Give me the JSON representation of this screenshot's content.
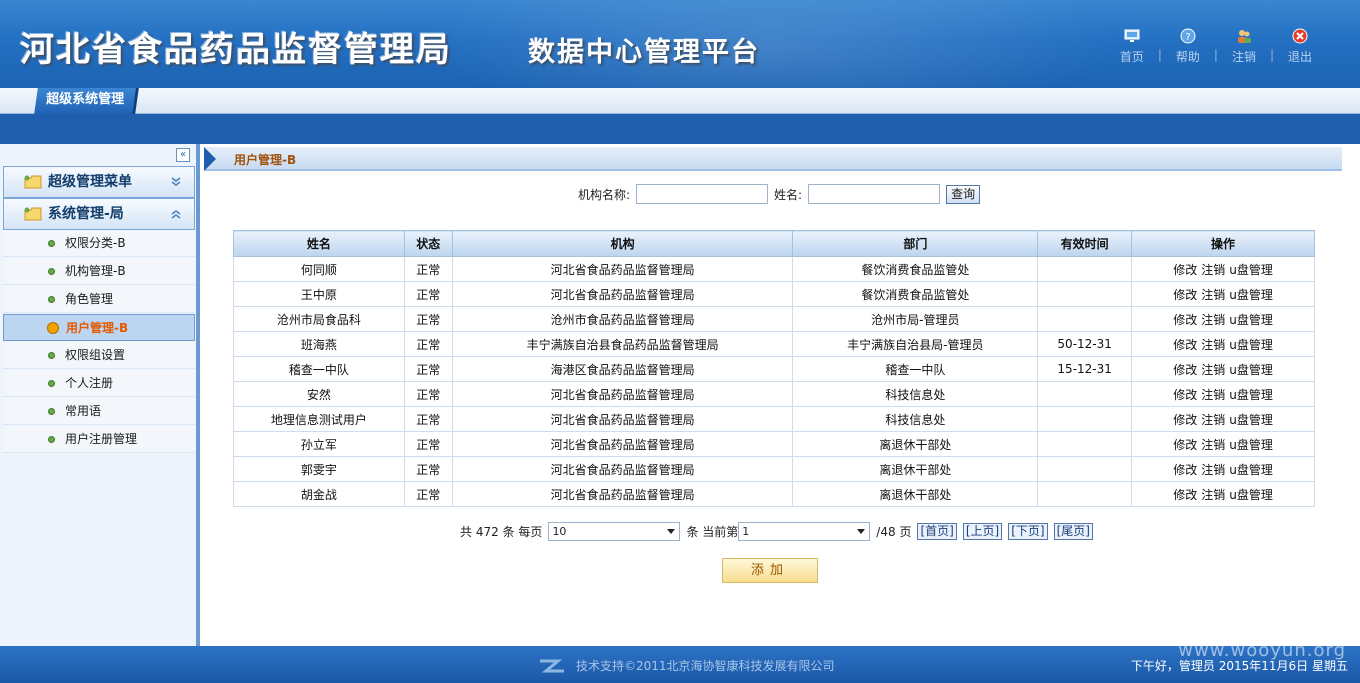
{
  "header": {
    "org_title": "河北省食品药品监督管理局",
    "platform_title": "数据中心管理平台",
    "nav": [
      {
        "label": "首页",
        "icon": "monitor-icon"
      },
      {
        "label": "帮助",
        "icon": "help-icon"
      },
      {
        "label": "注销",
        "icon": "users-icon"
      },
      {
        "label": "退出",
        "icon": "exit-icon"
      }
    ]
  },
  "tabs": {
    "active": "超级系统管理"
  },
  "sidebar": {
    "groups": [
      {
        "label": "超级管理菜单",
        "expanded": false
      },
      {
        "label": "系统管理-局",
        "expanded": true
      }
    ],
    "items": [
      {
        "label": "权限分类-B"
      },
      {
        "label": "机构管理-B"
      },
      {
        "label": "角色管理"
      },
      {
        "label": "用户管理-B",
        "active": true
      },
      {
        "label": "权限组设置"
      },
      {
        "label": "个人注册"
      },
      {
        "label": "常用语"
      },
      {
        "label": "用户注册管理"
      }
    ]
  },
  "main": {
    "breadcrumb": "用户管理-B",
    "search": {
      "org_label": "机构名称:",
      "org_value": "",
      "name_label": "姓名:",
      "name_value": "",
      "query_button": "查询"
    },
    "table": {
      "columns": [
        "姓名",
        "状态",
        "机构",
        "部门",
        "有效时间",
        "操作"
      ],
      "actions": [
        "修改",
        "注销",
        "u盘管理"
      ],
      "rows": [
        {
          "name": "何同顺",
          "status": "正常",
          "org": "河北省食品药品监督管理局",
          "dept": "餐饮消费食品监管处",
          "valid": ""
        },
        {
          "name": "王中原",
          "status": "正常",
          "org": "河北省食品药品监督管理局",
          "dept": "餐饮消费食品监管处",
          "valid": ""
        },
        {
          "name": "沧州市局食品科",
          "status": "正常",
          "org": "沧州市食品药品监督管理局",
          "dept": "沧州市局-管理员",
          "valid": ""
        },
        {
          "name": "班海燕",
          "status": "正常",
          "org": "丰宁满族自治县食品药品监督管理局",
          "dept": "丰宁满族自治县局-管理员",
          "valid": "50-12-31"
        },
        {
          "name": "稽查一中队",
          "status": "正常",
          "org": "海港区食品药品监督管理局",
          "dept": "稽查一中队",
          "valid": "15-12-31"
        },
        {
          "name": "安然",
          "status": "正常",
          "org": "河北省食品药品监督管理局",
          "dept": "科技信息处",
          "valid": ""
        },
        {
          "name": "地理信息测试用户",
          "status": "正常",
          "org": "河北省食品药品监督管理局",
          "dept": "科技信息处",
          "valid": ""
        },
        {
          "name": "孙立军",
          "status": "正常",
          "org": "河北省食品药品监督管理局",
          "dept": "离退休干部处",
          "valid": ""
        },
        {
          "name": "郭雯宇",
          "status": "正常",
          "org": "河北省食品药品监督管理局",
          "dept": "离退休干部处",
          "valid": ""
        },
        {
          "name": "胡金战",
          "status": "正常",
          "org": "河北省食品药品监督管理局",
          "dept": "离退休干部处",
          "valid": ""
        }
      ]
    },
    "pager": {
      "total_prefix": "共",
      "total": "472",
      "total_suffix": "条",
      "per_page_label": "每页",
      "per_page": "10",
      "unit": "条",
      "current_label": "当前第",
      "current": "1",
      "pages": "/48",
      "page_unit": "页",
      "first": "[首页]",
      "prev": "[上页]",
      "next": "[下页]",
      "last": "[尾页]"
    },
    "add_button": "添加"
  },
  "footer": {
    "support": "技术支持©2011北京海协智康科技发展有限公司",
    "status": "下午好，管理员 2015年11月6日 星期五"
  },
  "watermark": "www.wooyun.org",
  "colors": {
    "brand_blue": "#2470c2",
    "active_item_text": "#e35a00",
    "breadcrumb_text": "#a0520c"
  }
}
